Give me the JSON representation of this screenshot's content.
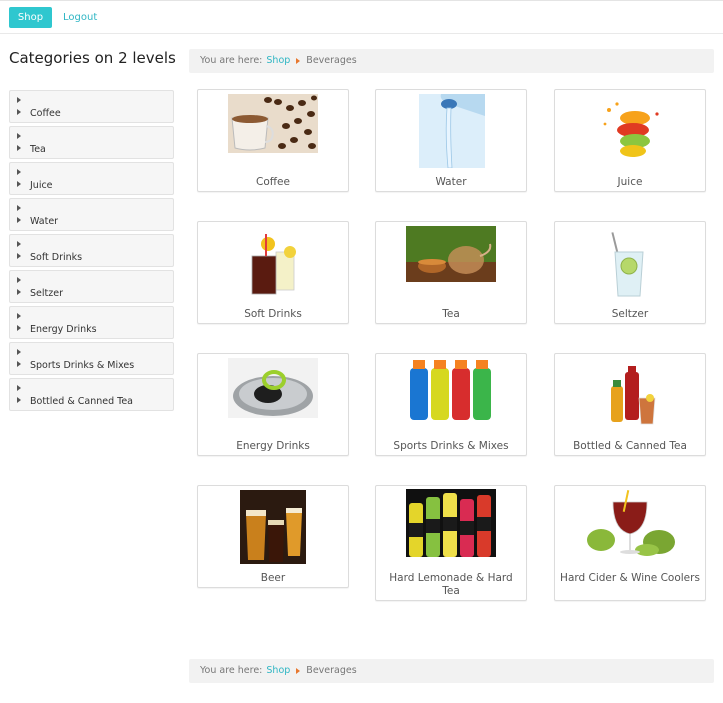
{
  "topbar": {
    "shop_label": "Shop",
    "logout_label": "Logout"
  },
  "sidebar": {
    "title": "Categories on 2 levels",
    "items": [
      {
        "label": "Coffee"
      },
      {
        "label": "Tea"
      },
      {
        "label": "Juice"
      },
      {
        "label": "Water"
      },
      {
        "label": "Soft Drinks"
      },
      {
        "label": "Seltzer"
      },
      {
        "label": "Energy Drinks"
      },
      {
        "label": "Sports Drinks & Mixes"
      },
      {
        "label": "Bottled & Canned Tea"
      }
    ]
  },
  "breadcrumb": {
    "prefix": "You are here:",
    "shop": "Shop",
    "current": "Beverages"
  },
  "products": [
    {
      "name": "Coffee"
    },
    {
      "name": "Water"
    },
    {
      "name": "Juice"
    },
    {
      "name": "Soft Drinks"
    },
    {
      "name": "Tea"
    },
    {
      "name": "Seltzer"
    },
    {
      "name": "Energy Drinks"
    },
    {
      "name": "Sports Drinks & Mixes"
    },
    {
      "name": "Bottled & Canned Tea"
    },
    {
      "name": "Beer"
    },
    {
      "name": "Hard Lemonade & Hard Tea"
    },
    {
      "name": "Hard Cider & Wine Coolers"
    }
  ],
  "icons": {
    "breadcrumb_separator": "triangle-right-icon",
    "category_arrow": "triangle-right-icon"
  },
  "colors": {
    "accent": "#2fc7cf",
    "link": "#2fb6c4",
    "separator": "#e8782f"
  }
}
